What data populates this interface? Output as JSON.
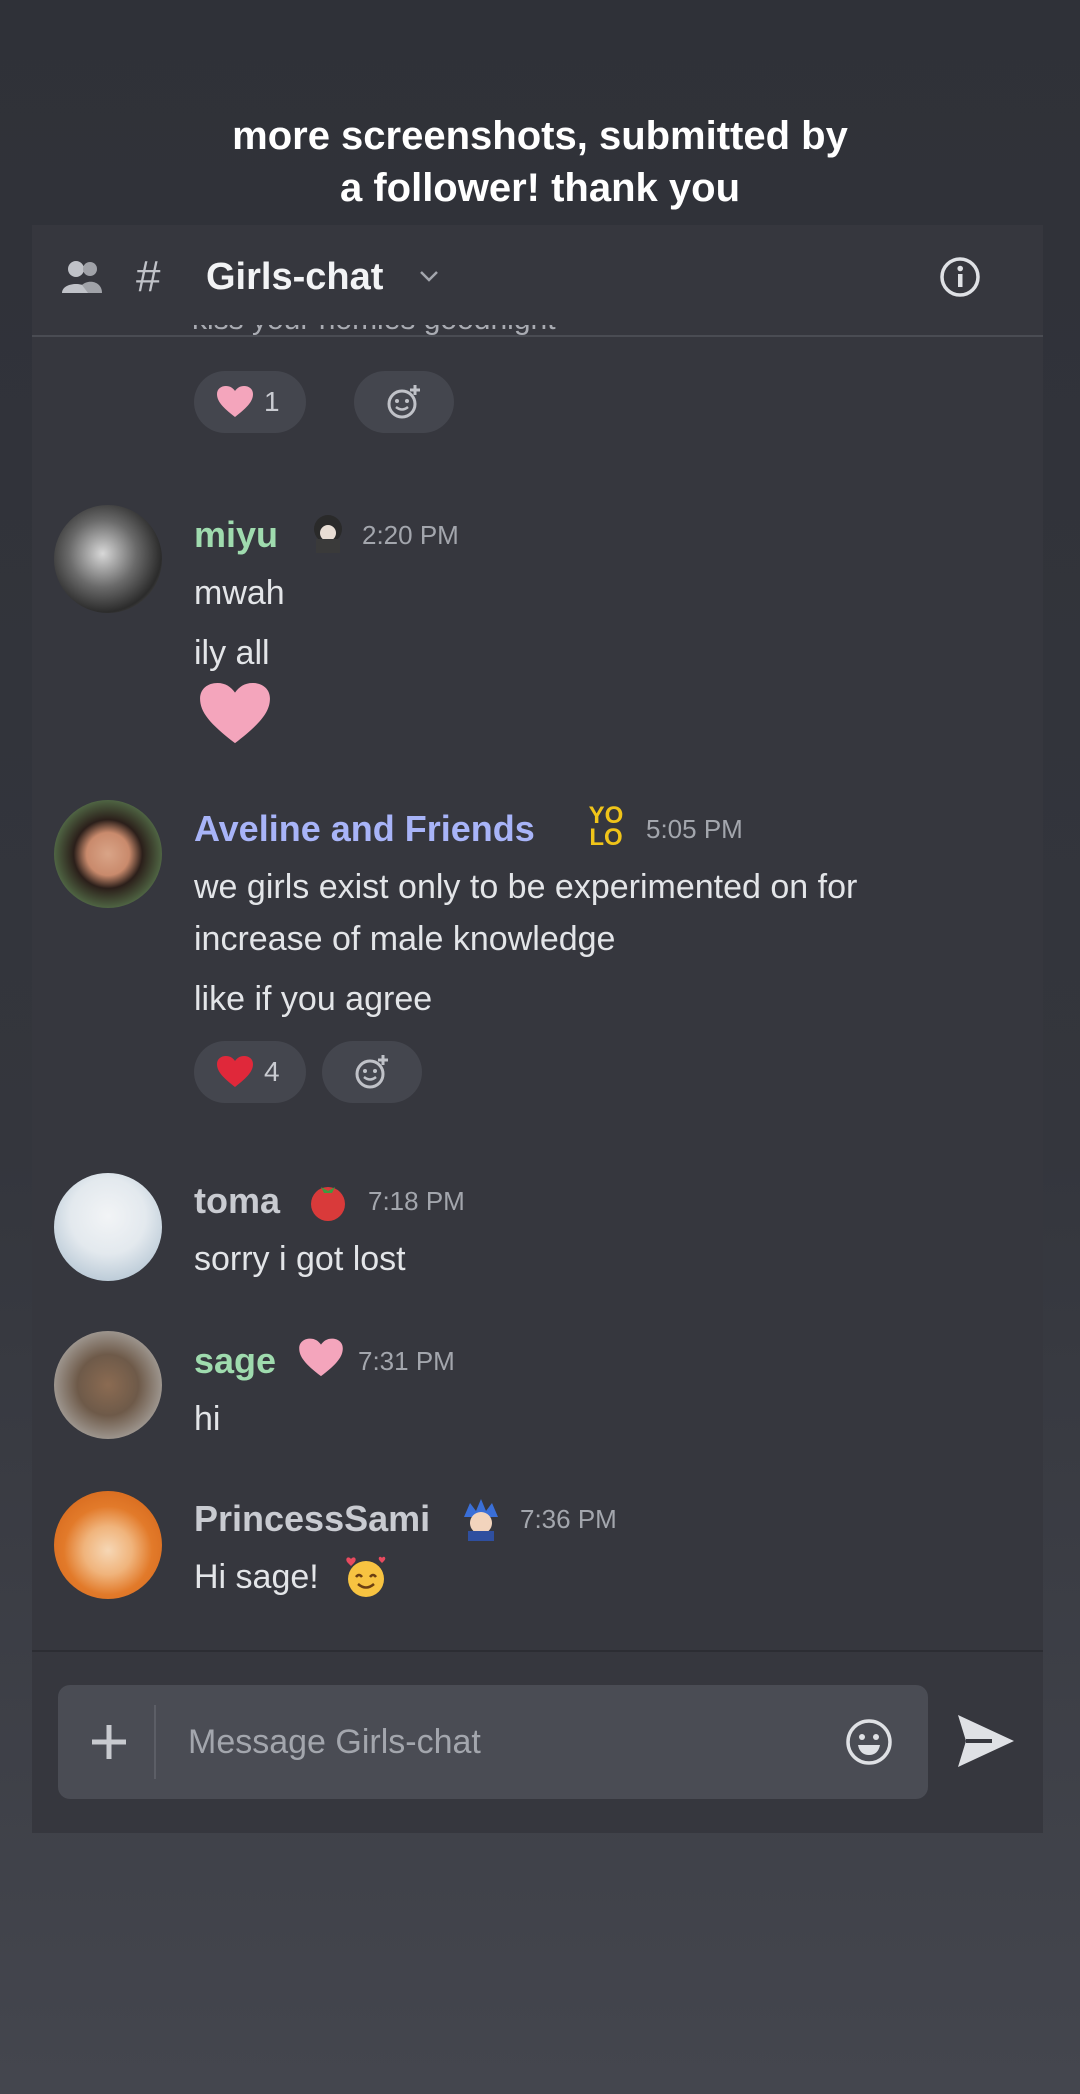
{
  "caption": {
    "line1": "more screenshots, submitted by",
    "line2": "a follower! thank you"
  },
  "channel": {
    "title": "Girls-chat",
    "hash": "#",
    "icons": [
      "members-icon",
      "chevron-down-icon",
      "info-icon"
    ]
  },
  "cutoff_message": "kiss your homies goodnight",
  "colors": {
    "miyu": "#9fdbae",
    "aveline": "#a8b4f8",
    "default_name": "#c9cbd1",
    "sage": "#9fdbae",
    "background": "#36373e"
  },
  "top_reaction": {
    "emoji": "pink-heart",
    "count": "1"
  },
  "messages": [
    {
      "author": "miyu",
      "time": "2:20 PM",
      "badge": "anime-girl-icon",
      "lines": [
        "mwah",
        "ily all"
      ],
      "emoji_line": "pink-heart"
    },
    {
      "author": "Aveline and Friends",
      "time": "5:05 PM",
      "badge": "yolo-icon",
      "badge_text": "YOLO",
      "lines": [
        "we girls exist only to be experimented on for",
        "increase of male knowledge",
        "like if you agree"
      ],
      "reaction": {
        "emoji": "red-heart",
        "count": "4"
      }
    },
    {
      "author": "toma",
      "time": "7:18 PM",
      "badge": "tomato-icon",
      "lines": [
        "sorry i got lost"
      ]
    },
    {
      "author": "sage",
      "time": "7:31 PM",
      "badge": "pink-heart-icon",
      "lines": [
        "hi"
      ]
    },
    {
      "author": "PrincessSami",
      "time": "7:36 PM",
      "badge": "blue-hair-character-icon",
      "lines": [
        "Hi sage!"
      ],
      "trailing_emoji": "smiling-face-with-hearts"
    }
  ],
  "composer": {
    "placeholder": "Message Girls-chat"
  }
}
